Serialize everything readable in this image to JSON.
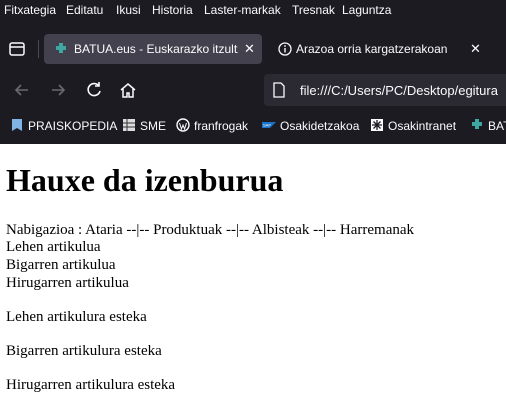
{
  "menu": [
    "Fitxategia",
    "Editatu",
    "Ikusi",
    "Historia",
    "Laster-markak",
    "Tresnak",
    "Laguntza"
  ],
  "tabs": [
    {
      "title": "BATUA.eus - Euskarazko itzultza",
      "icon": "puzzle-icon"
    },
    {
      "title": "Arazoa orria kargatzerakoan",
      "icon": "info-icon"
    }
  ],
  "address": {
    "url": "file:///C:/Users/PC/Desktop/egitura"
  },
  "bookmarks": [
    {
      "label": "PRAISKOPEDIA",
      "icon": "bookmark-icon"
    },
    {
      "label": "SME",
      "icon": "grid-icon"
    },
    {
      "label": "franfrogak",
      "icon": "wordpress-icon"
    },
    {
      "label": "Osakidetzakoa",
      "icon": "sap-icon"
    },
    {
      "label": "Osakintranet",
      "icon": "snowflake-icon"
    },
    {
      "label": "BAT",
      "icon": "puzzle-icon"
    }
  ],
  "page": {
    "title": "Hauxe da izenburua",
    "nav": "Nabigazioa : Ataria --|-- Produktuak --|-- Albisteak --|-- Harremanak",
    "articles": [
      "Lehen artikulua",
      "Bigarren artikulua",
      "Hirugarren artikulua"
    ],
    "links": [
      "Lehen artikulura esteka",
      "Bigarren artikulura esteka",
      "Hirugarren artikulura esteka"
    ]
  }
}
